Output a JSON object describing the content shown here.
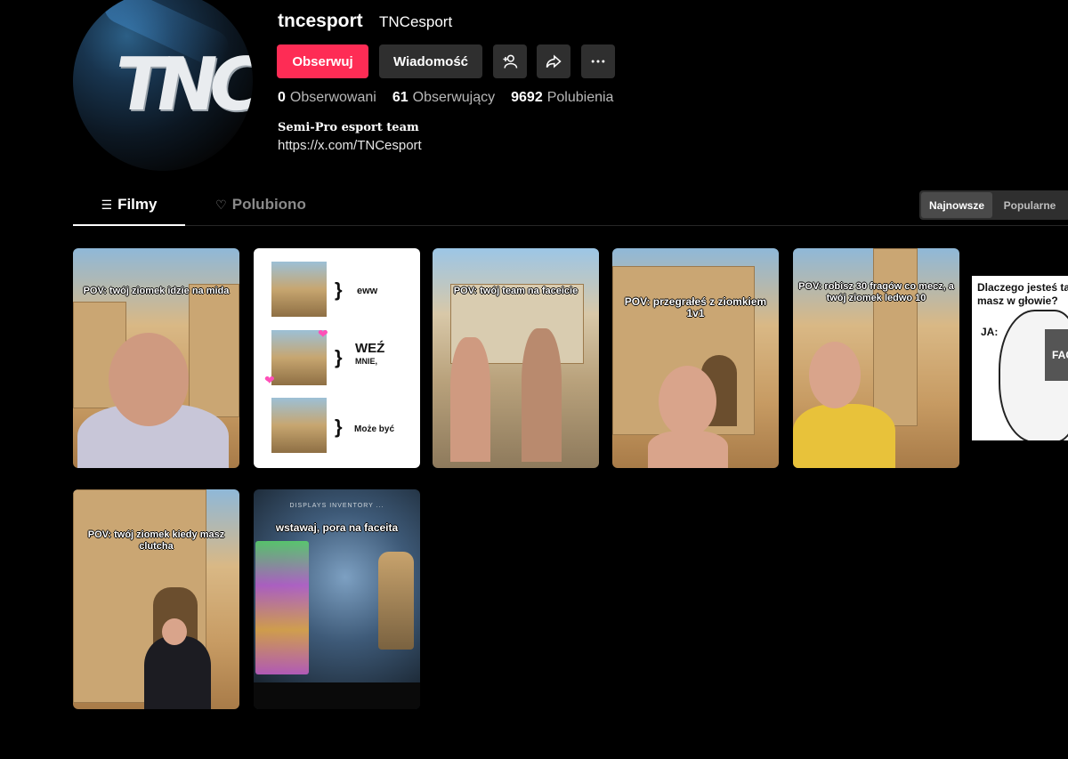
{
  "profile": {
    "username": "tncesport",
    "nickname": "TNCesport",
    "avatar_text": "TNC",
    "buttons": {
      "follow": "Obserwuj",
      "message": "Wiadomość",
      "add_user_icon": "add-user-icon",
      "share_icon": "share-icon",
      "more_icon": "more-icon"
    },
    "stats": [
      {
        "value": "0",
        "label": "Obserwowani"
      },
      {
        "value": "61",
        "label": "Obserwujący"
      },
      {
        "value": "9692",
        "label": "Polubienia"
      }
    ],
    "bio": "Semi-Pro esport team",
    "link": "https://x.com/TNCesport"
  },
  "tabs": {
    "videos": "Filmy",
    "liked": "Polubiono"
  },
  "sort": {
    "newest": "Najnowsze",
    "popular": "Popularne"
  },
  "videos": [
    {
      "caption": "POV: twój ziomek idzie na mida"
    },
    {
      "caption": "",
      "lines": [
        "eww",
        "WEŹ",
        "MNIE,",
        "Może być"
      ]
    },
    {
      "caption": "POV: twój team na faceicie"
    },
    {
      "caption": "POV: przegrałeś z ziomkiem 1v1"
    },
    {
      "caption": "POV: robisz 30 fragów co mecz, a twój ziomek ledwo 10"
    },
    {
      "caption": "Dlaczego jesteś tak masz w głowie?",
      "extra": "JA:",
      "badge": "FAC"
    },
    {
      "caption": "POV: twój ziomek kiedy masz clutcha"
    },
    {
      "caption": "wstawaj, pora na faceita",
      "menubar": "DISPLAYS   INVENTORY   ..."
    }
  ],
  "colors": {
    "accent": "#fe2c55",
    "button_dark": "#2f2f2f",
    "background": "#000000"
  }
}
